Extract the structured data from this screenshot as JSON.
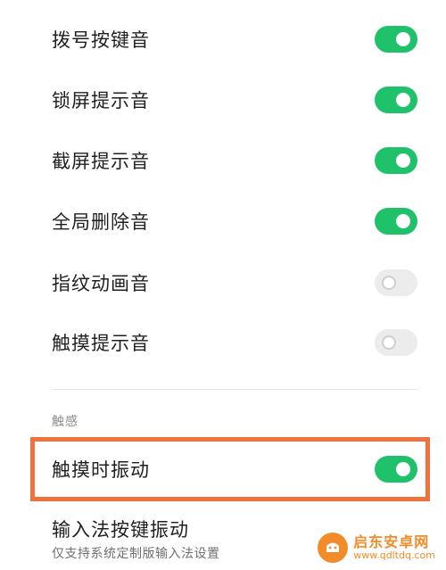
{
  "toggles": [
    {
      "label": "拨号按键音",
      "state": "on"
    },
    {
      "label": "锁屏提示音",
      "state": "on"
    },
    {
      "label": "截屏提示音",
      "state": "on"
    },
    {
      "label": "全局删除音",
      "state": "on"
    },
    {
      "label": "指纹动画音",
      "state": "off"
    },
    {
      "label": "触摸提示音",
      "state": "off"
    }
  ],
  "haptics": {
    "section_title": "触感",
    "touch_vibration": {
      "label": "触摸时振动",
      "state": "on"
    },
    "ime_vibration": {
      "label": "输入法按键振动",
      "sublabel": "仅支持系统定制版输入法设置"
    }
  },
  "watermark": {
    "title": "启东安卓网",
    "url": "www.qdltdq.com"
  },
  "colors": {
    "toggle_on": "#1fc26a",
    "toggle_off": "#ececec",
    "highlight": "#f0733f"
  }
}
